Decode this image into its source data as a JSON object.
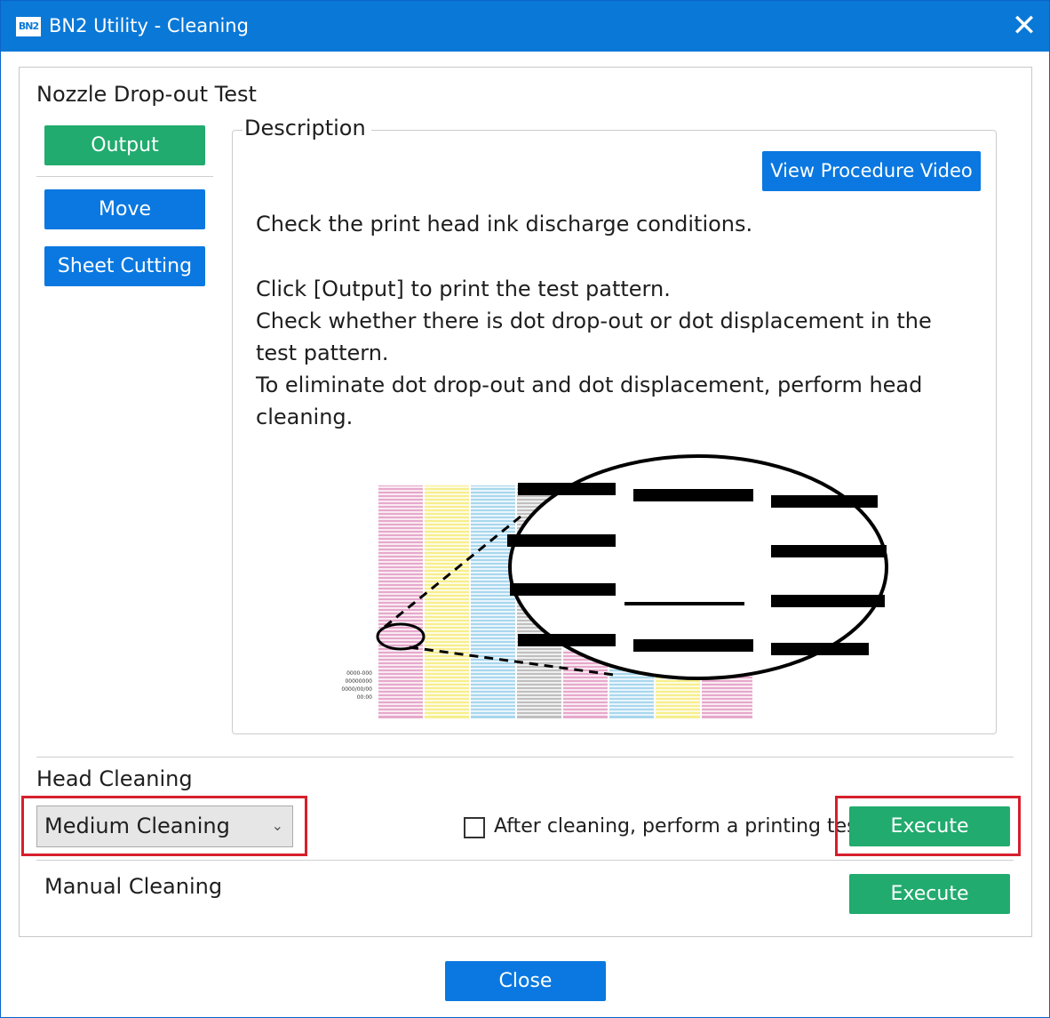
{
  "window": {
    "title": "BN2 Utility - Cleaning",
    "icon_text": "BN2",
    "close_glyph": "✕"
  },
  "nozzle_test": {
    "title": "Nozzle Drop-out Test",
    "output_label": "Output",
    "move_label": "Move",
    "sheet_cutting_label": "Sheet Cutting"
  },
  "description": {
    "legend": "Description",
    "video_button_label": "View Procedure Video",
    "lines": [
      "Check the print head ink discharge conditions.",
      "Click [Output] to print the test pattern.",
      "Check whether there is dot drop-out or dot displacement in the",
      "test pattern.",
      "To eliminate dot drop-out and dot displacement, perform head",
      "cleaning."
    ],
    "illustration_caption_lines": [
      "0000-000",
      "00000000",
      "0000/00/00",
      "00:00"
    ]
  },
  "head_cleaning": {
    "title": "Head Cleaning",
    "selected_option": "Medium Cleaning",
    "checkbox_label": "After cleaning, perform a printing test",
    "checkbox_checked": false,
    "execute_label": "Execute"
  },
  "manual_cleaning": {
    "title": "Manual Cleaning",
    "execute_label": "Execute"
  },
  "footer": {
    "close_label": "Close"
  },
  "colors": {
    "titlebar": "#0a78d7",
    "green_button": "#21ab6e",
    "blue_button": "#0a78e0",
    "highlight": "#d61f2c"
  }
}
